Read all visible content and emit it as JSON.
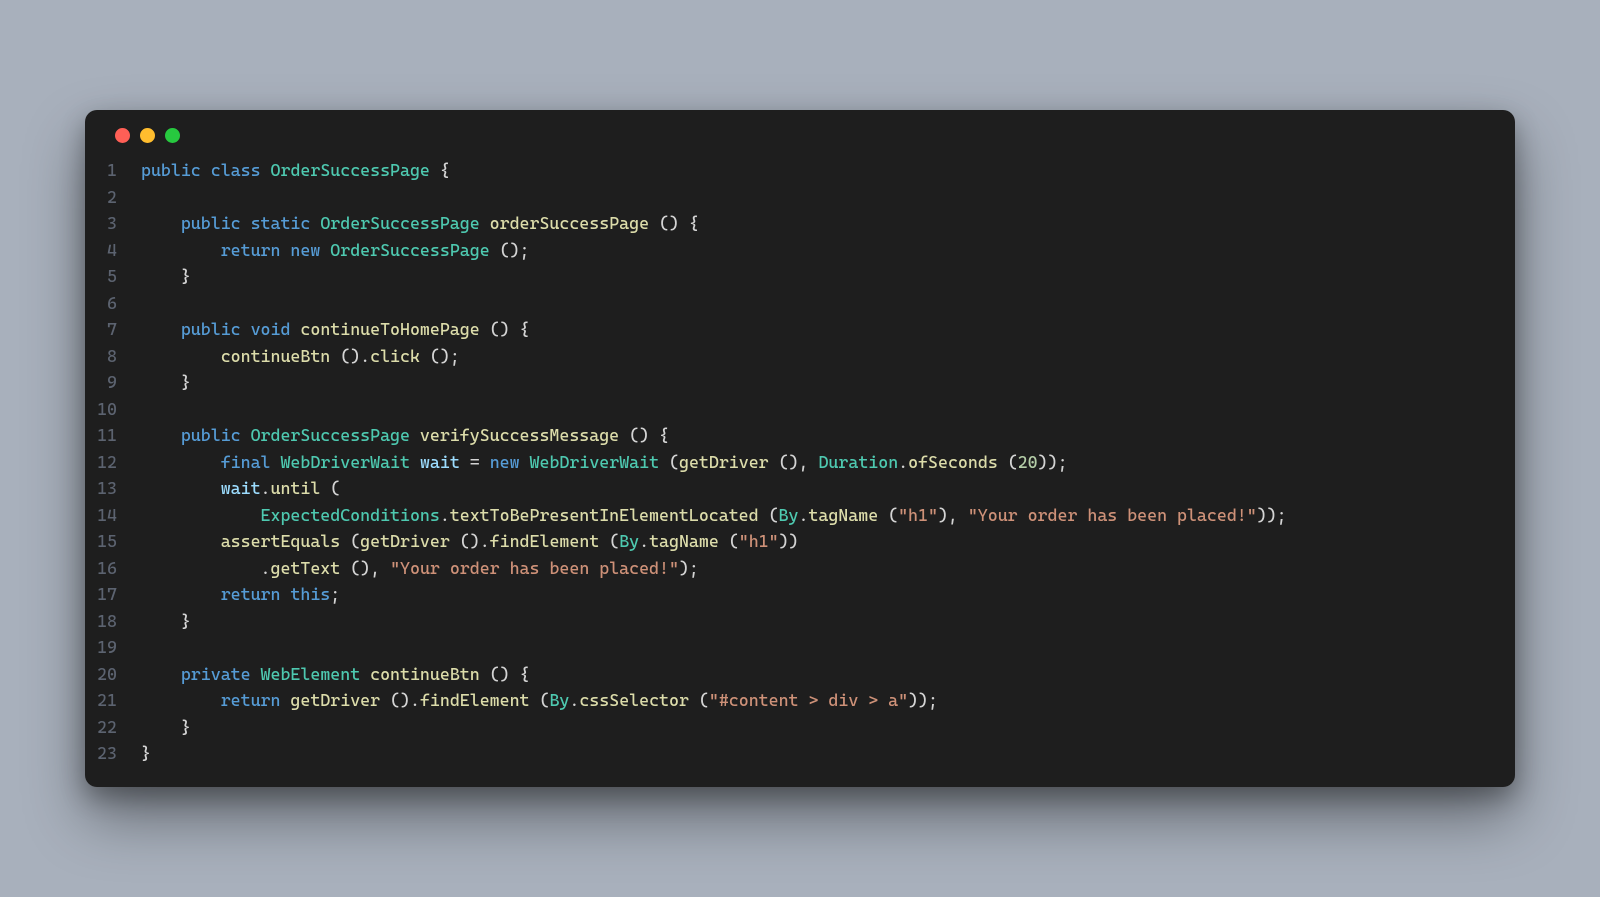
{
  "window": {
    "trafficLights": [
      "red",
      "yellow",
      "green"
    ]
  },
  "code": {
    "lines": [
      {
        "n": "1",
        "tokens": [
          [
            "kw",
            "public"
          ],
          [
            "",
            " "
          ],
          [
            "kw",
            "class"
          ],
          [
            "",
            " "
          ],
          [
            "type",
            "OrderSuccessPage"
          ],
          [
            "",
            " "
          ],
          [
            "punc",
            "{"
          ]
        ]
      },
      {
        "n": "2",
        "tokens": []
      },
      {
        "n": "3",
        "tokens": [
          [
            "",
            "    "
          ],
          [
            "kw",
            "public"
          ],
          [
            "",
            " "
          ],
          [
            "kw",
            "static"
          ],
          [
            "",
            " "
          ],
          [
            "type",
            "OrderSuccessPage"
          ],
          [
            "",
            " "
          ],
          [
            "method",
            "orderSuccessPage"
          ],
          [
            "",
            " "
          ],
          [
            "punc",
            "()"
          ],
          [
            "",
            " "
          ],
          [
            "punc",
            "{"
          ]
        ]
      },
      {
        "n": "4",
        "tokens": [
          [
            "",
            "        "
          ],
          [
            "kw",
            "return"
          ],
          [
            "",
            " "
          ],
          [
            "kw",
            "new"
          ],
          [
            "",
            " "
          ],
          [
            "type",
            "OrderSuccessPage"
          ],
          [
            "",
            " "
          ],
          [
            "punc",
            "();"
          ]
        ]
      },
      {
        "n": "5",
        "tokens": [
          [
            "",
            "    "
          ],
          [
            "punc",
            "}"
          ]
        ]
      },
      {
        "n": "6",
        "tokens": []
      },
      {
        "n": "7",
        "tokens": [
          [
            "",
            "    "
          ],
          [
            "kw",
            "public"
          ],
          [
            "",
            " "
          ],
          [
            "kw",
            "void"
          ],
          [
            "",
            " "
          ],
          [
            "method",
            "continueToHomePage"
          ],
          [
            "",
            " "
          ],
          [
            "punc",
            "()"
          ],
          [
            "",
            " "
          ],
          [
            "punc",
            "{"
          ]
        ]
      },
      {
        "n": "8",
        "tokens": [
          [
            "",
            "        "
          ],
          [
            "method",
            "continueBtn"
          ],
          [
            "",
            " "
          ],
          [
            "punc",
            "()."
          ],
          [
            "method",
            "click"
          ],
          [
            "",
            " "
          ],
          [
            "punc",
            "();"
          ]
        ]
      },
      {
        "n": "9",
        "tokens": [
          [
            "",
            "    "
          ],
          [
            "punc",
            "}"
          ]
        ]
      },
      {
        "n": "10",
        "tokens": []
      },
      {
        "n": "11",
        "tokens": [
          [
            "",
            "    "
          ],
          [
            "kw",
            "public"
          ],
          [
            "",
            " "
          ],
          [
            "type",
            "OrderSuccessPage"
          ],
          [
            "",
            " "
          ],
          [
            "method",
            "verifySuccessMessage"
          ],
          [
            "",
            " "
          ],
          [
            "punc",
            "()"
          ],
          [
            "",
            " "
          ],
          [
            "punc",
            "{"
          ]
        ]
      },
      {
        "n": "12",
        "tokens": [
          [
            "",
            "        "
          ],
          [
            "kw",
            "final"
          ],
          [
            "",
            " "
          ],
          [
            "type",
            "WebDriverWait"
          ],
          [
            "",
            " "
          ],
          [
            "var",
            "wait"
          ],
          [
            "",
            " "
          ],
          [
            "punc",
            "="
          ],
          [
            "",
            " "
          ],
          [
            "kw",
            "new"
          ],
          [
            "",
            " "
          ],
          [
            "type",
            "WebDriverWait"
          ],
          [
            "",
            " "
          ],
          [
            "punc",
            "("
          ],
          [
            "method",
            "getDriver"
          ],
          [
            "",
            " "
          ],
          [
            "punc",
            "(),"
          ],
          [
            "",
            " "
          ],
          [
            "type",
            "Duration"
          ],
          [
            "punc",
            "."
          ],
          [
            "method",
            "ofSeconds"
          ],
          [
            "",
            " "
          ],
          [
            "punc",
            "("
          ],
          [
            "num",
            "20"
          ],
          [
            "punc",
            "));"
          ]
        ]
      },
      {
        "n": "13",
        "tokens": [
          [
            "",
            "        "
          ],
          [
            "var",
            "wait"
          ],
          [
            "punc",
            "."
          ],
          [
            "method",
            "until"
          ],
          [
            "",
            " "
          ],
          [
            "punc",
            "("
          ]
        ]
      },
      {
        "n": "14",
        "tokens": [
          [
            "",
            "            "
          ],
          [
            "type",
            "ExpectedConditions"
          ],
          [
            "punc",
            "."
          ],
          [
            "method",
            "textToBePresentInElementLocated"
          ],
          [
            "",
            " "
          ],
          [
            "punc",
            "("
          ],
          [
            "type",
            "By"
          ],
          [
            "punc",
            "."
          ],
          [
            "method",
            "tagName"
          ],
          [
            "",
            " "
          ],
          [
            "punc",
            "("
          ],
          [
            "str",
            "\"h1\""
          ],
          [
            "punc",
            "),"
          ],
          [
            "",
            " "
          ],
          [
            "str",
            "\"Your order has been placed!\""
          ],
          [
            "punc",
            "));"
          ]
        ]
      },
      {
        "n": "15",
        "tokens": [
          [
            "",
            "        "
          ],
          [
            "method",
            "assertEquals"
          ],
          [
            "",
            " "
          ],
          [
            "punc",
            "("
          ],
          [
            "method",
            "getDriver"
          ],
          [
            "",
            " "
          ],
          [
            "punc",
            "()."
          ],
          [
            "method",
            "findElement"
          ],
          [
            "",
            " "
          ],
          [
            "punc",
            "("
          ],
          [
            "type",
            "By"
          ],
          [
            "punc",
            "."
          ],
          [
            "method",
            "tagName"
          ],
          [
            "",
            " "
          ],
          [
            "punc",
            "("
          ],
          [
            "str",
            "\"h1\""
          ],
          [
            "punc",
            "))"
          ]
        ]
      },
      {
        "n": "16",
        "tokens": [
          [
            "",
            "            "
          ],
          [
            "punc",
            "."
          ],
          [
            "method",
            "getText"
          ],
          [
            "",
            " "
          ],
          [
            "punc",
            "(),"
          ],
          [
            "",
            " "
          ],
          [
            "str",
            "\"Your order has been placed!\""
          ],
          [
            "punc",
            ");"
          ]
        ]
      },
      {
        "n": "17",
        "tokens": [
          [
            "",
            "        "
          ],
          [
            "kw",
            "return"
          ],
          [
            "",
            " "
          ],
          [
            "this",
            "this"
          ],
          [
            "punc",
            ";"
          ]
        ]
      },
      {
        "n": "18",
        "tokens": [
          [
            "",
            "    "
          ],
          [
            "punc",
            "}"
          ]
        ]
      },
      {
        "n": "19",
        "tokens": []
      },
      {
        "n": "20",
        "tokens": [
          [
            "",
            "    "
          ],
          [
            "kw",
            "private"
          ],
          [
            "",
            " "
          ],
          [
            "type",
            "WebElement"
          ],
          [
            "",
            " "
          ],
          [
            "method",
            "continueBtn"
          ],
          [
            "",
            " "
          ],
          [
            "punc",
            "()"
          ],
          [
            "",
            " "
          ],
          [
            "punc",
            "{"
          ]
        ]
      },
      {
        "n": "21",
        "tokens": [
          [
            "",
            "        "
          ],
          [
            "kw",
            "return"
          ],
          [
            "",
            " "
          ],
          [
            "method",
            "getDriver"
          ],
          [
            "",
            " "
          ],
          [
            "punc",
            "()."
          ],
          [
            "method",
            "findElement"
          ],
          [
            "",
            " "
          ],
          [
            "punc",
            "("
          ],
          [
            "type",
            "By"
          ],
          [
            "punc",
            "."
          ],
          [
            "method",
            "cssSelector"
          ],
          [
            "",
            " "
          ],
          [
            "punc",
            "("
          ],
          [
            "str",
            "\"#content > div > a\""
          ],
          [
            "punc",
            "));"
          ]
        ]
      },
      {
        "n": "22",
        "tokens": [
          [
            "",
            "    "
          ],
          [
            "punc",
            "}"
          ]
        ]
      },
      {
        "n": "23",
        "tokens": [
          [
            "punc",
            "}"
          ]
        ]
      }
    ]
  }
}
